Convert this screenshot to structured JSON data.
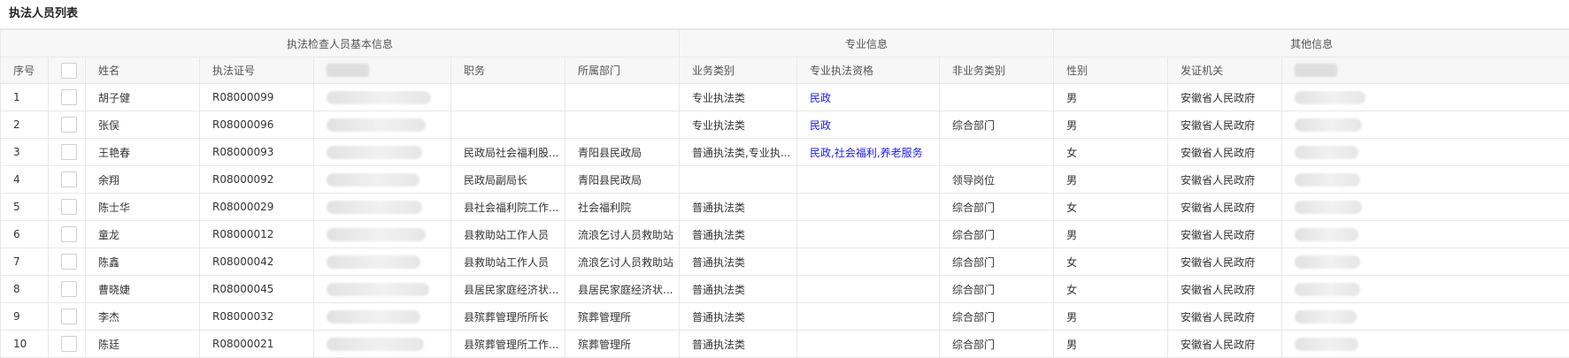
{
  "page": {
    "title": "执法人员列表"
  },
  "table": {
    "groups": [
      "执法检查人员基本信息",
      "专业信息",
      "其他信息"
    ],
    "columns": [
      "序号",
      "",
      "姓名",
      "执法证号",
      "",
      "职务",
      "所属部门",
      "业务类别",
      "专业执法资格",
      "非业务类别",
      "性别",
      "发证机关",
      ""
    ],
    "rows": [
      {
        "idx": "1",
        "name": "胡子健",
        "cert": "R08000099",
        "title": "",
        "dept": "",
        "biz": "专业执法类",
        "qual": "民政",
        "nonbiz": "",
        "gender": "男",
        "issuer": "安徽省人民政府"
      },
      {
        "idx": "2",
        "name": "张俣",
        "cert": "R08000096",
        "title": "",
        "dept": "",
        "biz": "专业执法类",
        "qual": "民政",
        "nonbiz": "综合部门",
        "gender": "男",
        "issuer": "安徽省人民政府"
      },
      {
        "idx": "3",
        "name": "王艳春",
        "cert": "R08000093",
        "title": "民政局社会福利股...",
        "dept": "青阳县民政局",
        "biz": "普通执法类,专业执...",
        "qual": "民政,社会福利,养老服务",
        "nonbiz": "",
        "gender": "女",
        "issuer": "安徽省人民政府"
      },
      {
        "idx": "4",
        "name": "余翔",
        "cert": "R08000092",
        "title": "民政局副局长",
        "dept": "青阳县民政局",
        "biz": "",
        "qual": "",
        "nonbiz": "领导岗位",
        "gender": "男",
        "issuer": "安徽省人民政府"
      },
      {
        "idx": "5",
        "name": "陈士华",
        "cert": "R08000029",
        "title": "县社会福利院工作...",
        "dept": "社会福利院",
        "biz": "普通执法类",
        "qual": "",
        "nonbiz": "综合部门",
        "gender": "女",
        "issuer": "安徽省人民政府"
      },
      {
        "idx": "6",
        "name": "童龙",
        "cert": "R08000012",
        "title": "县救助站工作人员",
        "dept": "流浪乞讨人员救助站",
        "biz": "普通执法类",
        "qual": "",
        "nonbiz": "综合部门",
        "gender": "男",
        "issuer": "安徽省人民政府"
      },
      {
        "idx": "7",
        "name": "陈鑫",
        "cert": "R08000042",
        "title": "县救助站工作人员",
        "dept": "流浪乞讨人员救助站",
        "biz": "普通执法类",
        "qual": "",
        "nonbiz": "综合部门",
        "gender": "女",
        "issuer": "安徽省人民政府"
      },
      {
        "idx": "8",
        "name": "曹晓婕",
        "cert": "R08000045",
        "title": "县居民家庭经济状...",
        "dept": "县居民家庭经济状...",
        "biz": "普通执法类",
        "qual": "",
        "nonbiz": "综合部门",
        "gender": "女",
        "issuer": "安徽省人民政府"
      },
      {
        "idx": "9",
        "name": "李杰",
        "cert": "R08000032",
        "title": "县殡葬管理所所长",
        "dept": "殡葬管理所",
        "biz": "普通执法类",
        "qual": "",
        "nonbiz": "综合部门",
        "gender": "男",
        "issuer": "安徽省人民政府"
      },
      {
        "idx": "10",
        "name": "陈廷",
        "cert": "R08000021",
        "title": "县殡葬管理所工作...",
        "dept": "殡葬管理所",
        "biz": "普通执法类",
        "qual": "",
        "nonbiz": "综合部门",
        "gender": "男",
        "issuer": "安徽省人民政府"
      }
    ]
  },
  "colors": {
    "link": "#1a1aff",
    "header_bg": "#f7f7f7",
    "border": "#e8e8e8"
  }
}
